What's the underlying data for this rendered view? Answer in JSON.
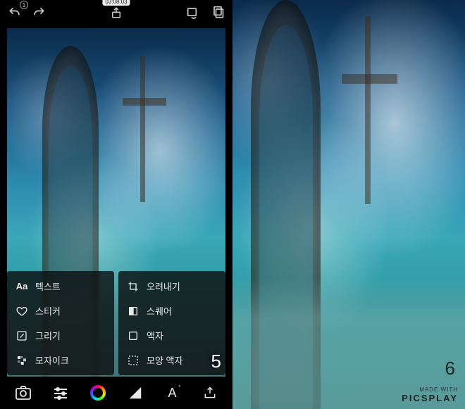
{
  "topbar": {
    "undo_badge": "1",
    "timestamp": "03:08:03"
  },
  "menu": {
    "col1": [
      {
        "icon": "text-aa-icon",
        "label": "텍스트"
      },
      {
        "icon": "heart-icon",
        "label": "스티커"
      },
      {
        "icon": "pencil-icon",
        "label": "그리기"
      },
      {
        "icon": "mosaic-icon",
        "label": "모자이크"
      }
    ],
    "col2": [
      {
        "icon": "crop-icon",
        "label": "오려내기"
      },
      {
        "icon": "square-half-icon",
        "label": "스퀘어"
      },
      {
        "icon": "frame-icon",
        "label": "액자"
      },
      {
        "icon": "shape-frame-icon",
        "label": "모양 액자"
      }
    ]
  },
  "page_left": "5",
  "page_right": "6",
  "watermark": {
    "made": "MADE WITH",
    "brand": "PICSPLAY"
  }
}
